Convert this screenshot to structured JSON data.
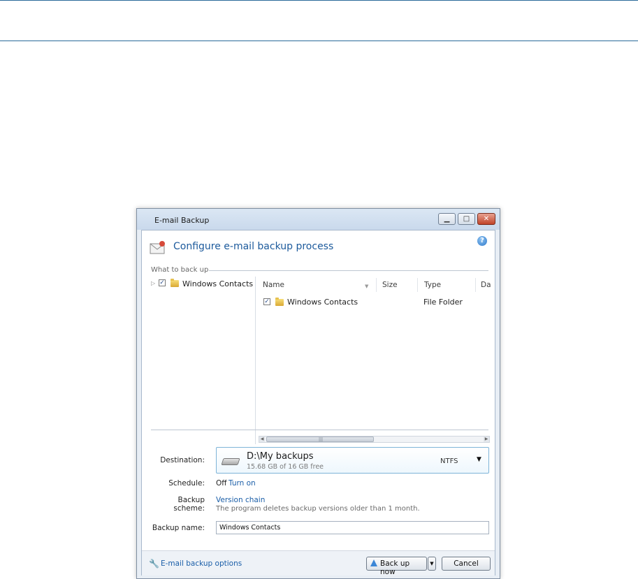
{
  "window": {
    "title": "E-mail Backup",
    "header_title": "Configure e-mail backup process",
    "controls": {
      "minimize": "▁",
      "maximize": "□",
      "close": "✕"
    }
  },
  "what_to_backup": {
    "section_label": "What to back up",
    "tree": [
      {
        "label": "Windows Contacts",
        "checked": true
      }
    ],
    "columns": [
      "Name",
      "Size",
      "Type",
      "Da"
    ],
    "rows": [
      {
        "name": "Windows Contacts",
        "type": "File Folder",
        "checked": true
      }
    ]
  },
  "form": {
    "destination_label": "Destination:",
    "destination": {
      "path": "D:\\My backups",
      "free": "15.68 GB of 16 GB free",
      "fs": "NTFS"
    },
    "schedule_label": "Schedule:",
    "schedule_state": "Off",
    "schedule_link": "Turn on",
    "scheme_label": "Backup scheme:",
    "scheme_link": "Version chain",
    "scheme_desc": "The program deletes backup versions older than 1 month.",
    "name_label": "Backup name:",
    "name_value": "Windows Contacts"
  },
  "footer": {
    "options_link": "E-mail backup options",
    "backup_button": "Back up now",
    "cancel_button": "Cancel"
  },
  "colors": {
    "accent": "#1c5a9c",
    "link": "#1a5ea8",
    "rule": "#2a6a9a"
  },
  "icons": {
    "header": "email-backup-icon",
    "help": "help-icon",
    "folder": "folder-icon",
    "drive": "hard-drive-icon",
    "options": "wrench-icon",
    "backup": "up-arrow-icon"
  }
}
